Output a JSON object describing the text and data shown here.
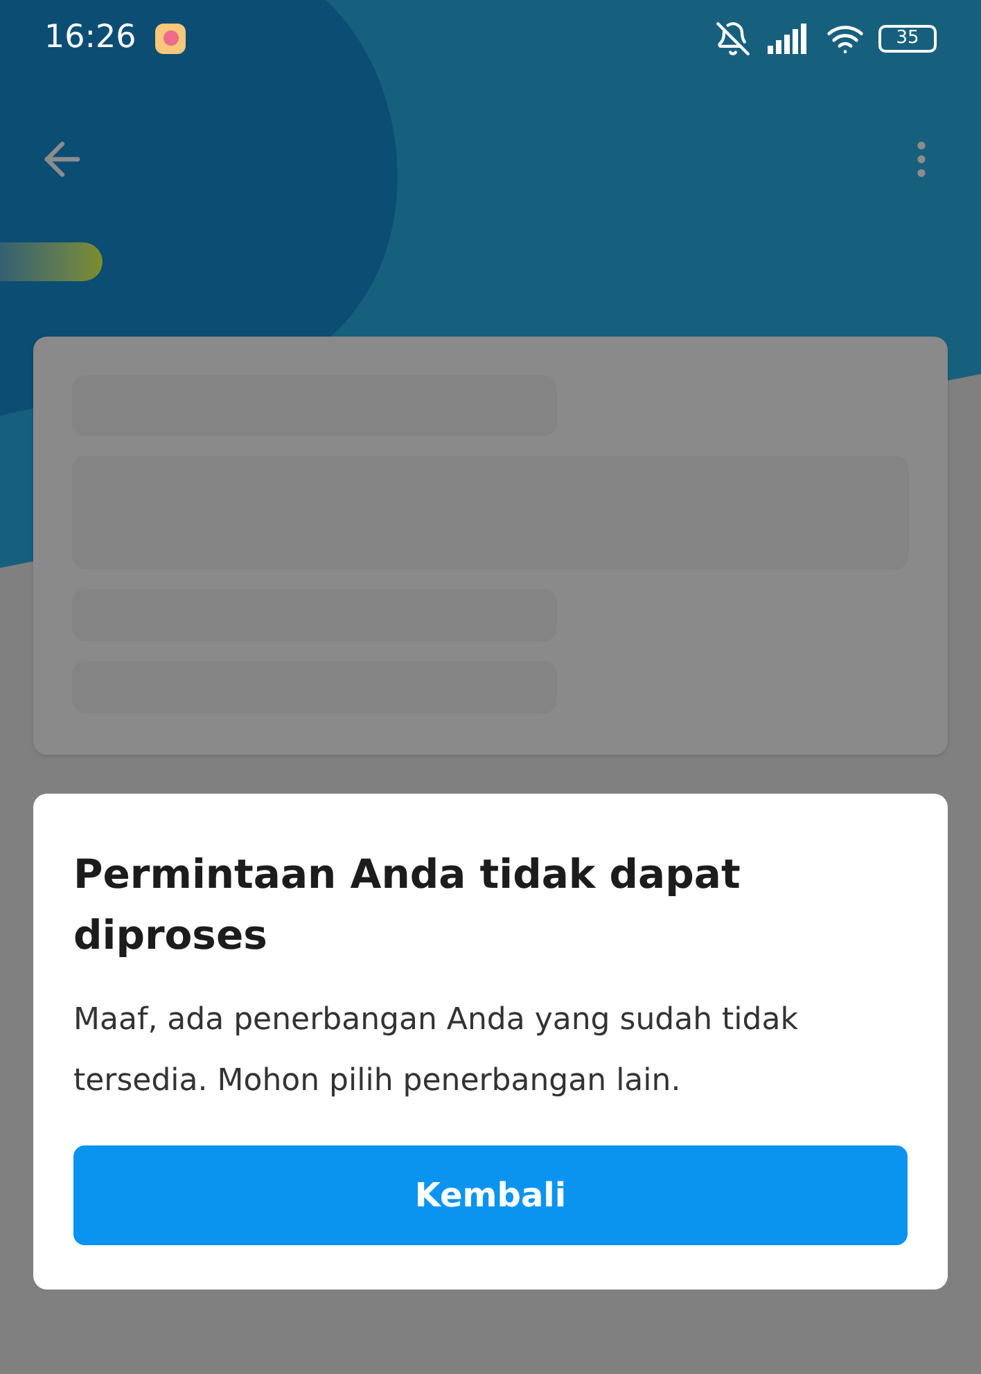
{
  "status_bar": {
    "time": "16:26",
    "battery": "35"
  },
  "dialog": {
    "title": "Permintaan Anda tidak dapat diproses",
    "message": "Maaf, ada penerbangan Anda yang sudah tidak tersedia. Mohon pilih penerbangan lain.",
    "button": "Kembali"
  }
}
